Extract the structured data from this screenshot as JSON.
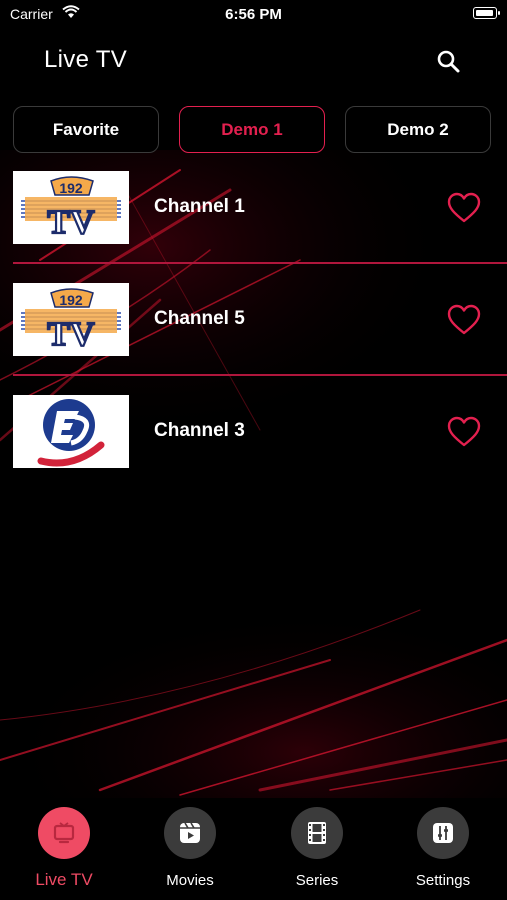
{
  "status_bar": {
    "carrier": "Carrier",
    "time": "6:56 PM"
  },
  "header": {
    "title": "Live TV",
    "search_icon": "search-icon"
  },
  "filters": [
    {
      "label": "Favorite",
      "active": false
    },
    {
      "label": "Demo 1",
      "active": true
    },
    {
      "label": "Demo 2",
      "active": false
    }
  ],
  "channels": [
    {
      "name": "Channel 1",
      "logo": "192 TV",
      "logo_top": "192",
      "logo_bottom": "TV"
    },
    {
      "name": "Channel 5",
      "logo": "192 TV",
      "logo_top": "192",
      "logo_bottom": "TV"
    },
    {
      "name": "Channel 3",
      "logo": "E3"
    }
  ],
  "tabs": [
    {
      "label": "Live TV",
      "icon": "tv-icon",
      "active": true
    },
    {
      "label": "Movies",
      "icon": "movies-icon",
      "active": false
    },
    {
      "label": "Series",
      "icon": "film-strip-icon",
      "active": false
    },
    {
      "label": "Settings",
      "icon": "sliders-icon",
      "active": false
    }
  ],
  "colors": {
    "accent": "#e3204f",
    "tab_active": "#ef4b64",
    "background": "#000000",
    "divider": "#b0163c"
  }
}
